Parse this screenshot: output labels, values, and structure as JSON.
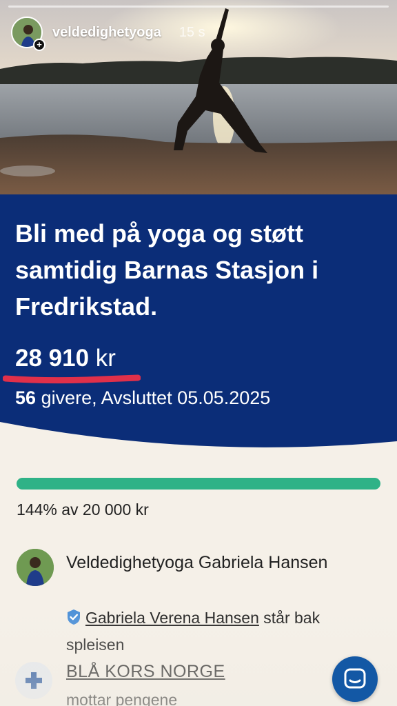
{
  "story": {
    "username": "veldedighetyoga",
    "time": "15 s"
  },
  "campaign": {
    "headline": "Bli med på yoga og støtt samtidig Barnas Stasjon i Fredrikstad.",
    "amount_number": "28 910",
    "amount_unit": "kr",
    "givers_count": "56",
    "givers_text": "givere, Avsluttet 05.05.2025",
    "progress_percent": 144,
    "goal_text": "144% av 20 000 kr"
  },
  "organizer": {
    "name": "Veldedighetyoga Gabriela Hansen",
    "verified_person": "Gabriela Verena Hansen",
    "verified_suffix": "står bak spleisen"
  },
  "charity": {
    "name": "BLÅ KORS NORGE",
    "subtitle": "mottar pengene"
  },
  "colors": {
    "card_blue": "#0b2d78",
    "progress_green": "#2fb287",
    "background": "#f5f0e8",
    "fab_blue": "#1358a5",
    "underline_red": "#e0304a"
  },
  "icons": {
    "verified": "shield-check-icon",
    "charity": "plus-cross-icon",
    "chat": "chat-bubble-icon"
  }
}
